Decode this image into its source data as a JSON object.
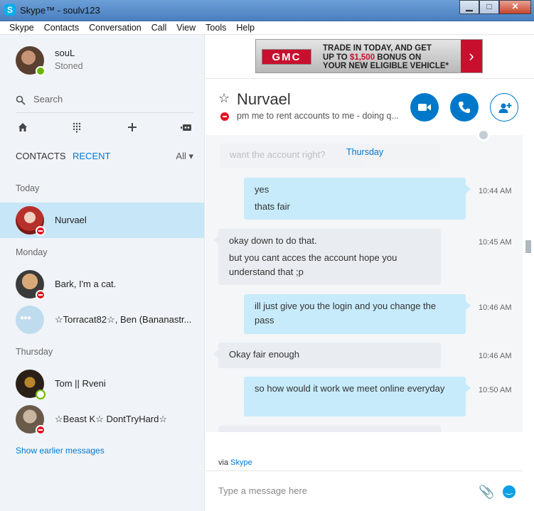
{
  "window": {
    "title": "Skype™ - soulv123",
    "logo_letter": "S",
    "min": "▁",
    "max": "□",
    "close": "✕"
  },
  "menu": [
    "Skype",
    "Contacts",
    "Conversation",
    "Call",
    "View",
    "Tools",
    "Help"
  ],
  "profile": {
    "name": "souL",
    "mood": "Stoned",
    "status": "online"
  },
  "search": {
    "placeholder": "Search"
  },
  "tabs": {
    "contacts": "CONTACTS",
    "recent": "RECENT",
    "filter": "All ▾"
  },
  "sections": {
    "today": "Today",
    "monday": "Monday",
    "thursday": "Thursday"
  },
  "contacts": [
    {
      "name": "Nurvael",
      "status": "dnd",
      "selected": true
    },
    {
      "name": "Bark, I'm a cat.",
      "status": "dnd"
    },
    {
      "name": "☆Torracat82☆, Ben (Bananastr...",
      "status": "none"
    },
    {
      "name": "Tom || Rveni",
      "status": "away"
    },
    {
      "name": "☆Beast K☆ DontTryHard☆",
      "status": "dnd"
    }
  ],
  "show_earlier": "Show earlier messages",
  "ad": {
    "brand": "GMC",
    "line1": "TRADE IN TODAY, AND GET",
    "line2_pre": "UP TO ",
    "line2_amount": "$1,500",
    "line2_post": " BONUS ON",
    "line3": "YOUR NEW ELIGIBLE VEHICLE",
    "line3_mark": "*",
    "arrow": "›"
  },
  "conversation": {
    "name": "Nurvael",
    "mood": "pm me to rent accounts to me - doing q...",
    "faded_preview": "want the account right?",
    "day_label": "Thursday",
    "messages": [
      {
        "dir": "out",
        "lines": [
          "yes",
          "thats fair"
        ],
        "time": "10:44 AM"
      },
      {
        "dir": "in",
        "lines": [
          "okay down to do that.",
          "but you cant acces the account hope you understand that ;p"
        ],
        "time": "10:45 AM"
      },
      {
        "dir": "out",
        "lines": [
          "ill just give you the login and you change the pass"
        ],
        "time": "10:46 AM"
      },
      {
        "dir": "in",
        "lines": [
          "Okay fair enough"
        ],
        "time": "10:46 AM"
      },
      {
        "dir": "out",
        "lines": [
          "so how would it work  we meet online everyday"
        ],
        "time": "10:50 AM"
      }
    ]
  },
  "via": {
    "prefix": "via ",
    "link": "Skype"
  },
  "composer": {
    "placeholder": "Type a message here"
  },
  "colors": {
    "accent": "#0078ca",
    "dnd": "#e81123",
    "online": "#6bb700",
    "outgoing_bubble": "#c7ebfb"
  }
}
